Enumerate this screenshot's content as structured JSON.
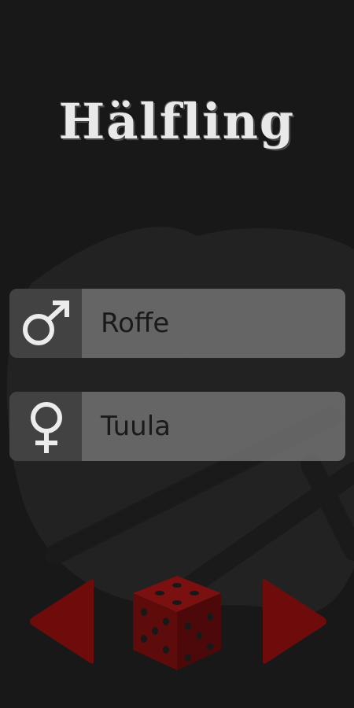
{
  "app": {
    "title": "Hälfling"
  },
  "names": {
    "male": {
      "label": "Roffe",
      "icon": "male-symbol-icon"
    },
    "female": {
      "label": "Tuula",
      "icon": "female-symbol-icon"
    }
  },
  "controls": {
    "prev_icon": "left-triangle-icon",
    "random_icon": "dice-icon",
    "next_icon": "right-triangle-icon"
  },
  "colors": {
    "background": "#181818",
    "accent": "#6e0c0c",
    "button_fill": "#7a7a7a"
  }
}
